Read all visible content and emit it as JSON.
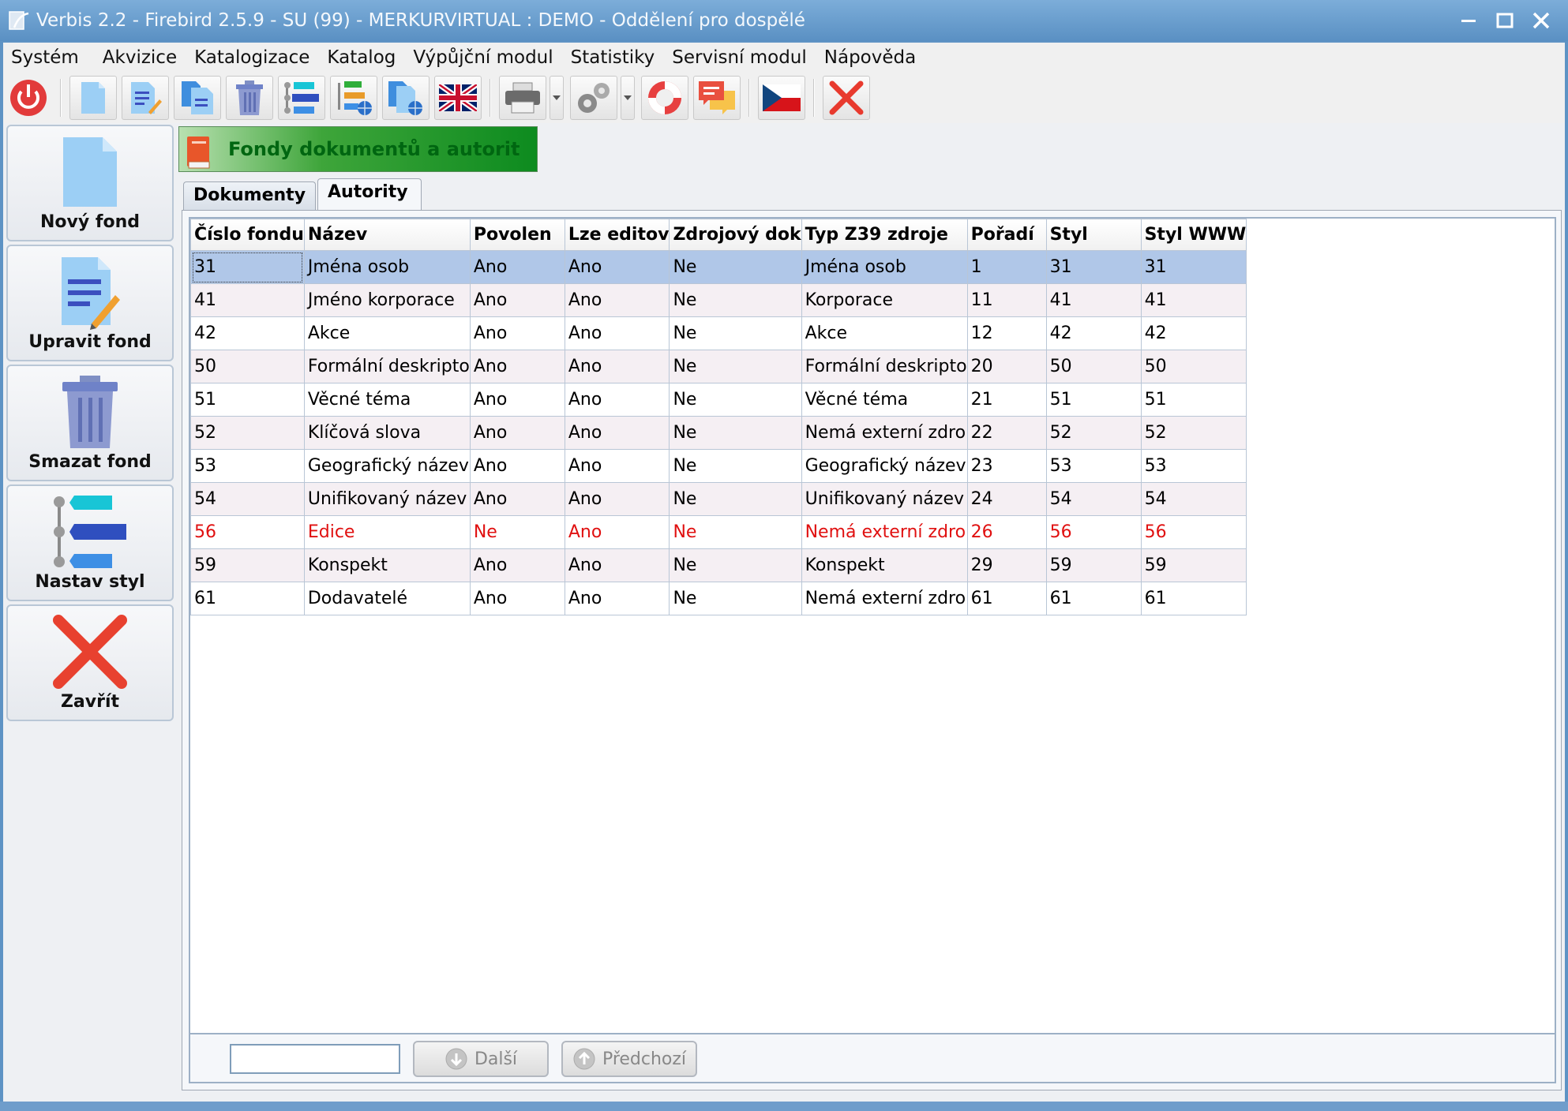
{
  "window": {
    "title": "Verbis 2.2 - Firebird 2.5.9 - SU (99) - MERKURVIRTUAL : DEMO - Oddělení pro dospělé"
  },
  "menu": [
    "Systém",
    "Akvizice",
    "Katalogizace",
    "Katalog",
    "Výpůjční modul",
    "Statistiky",
    "Servisní modul",
    "Nápověda"
  ],
  "sidebar": {
    "new_fund": "Nový fond",
    "edit_fund": "Upravit fond",
    "delete_fund": "Smazat fond",
    "set_style": "Nastav styl",
    "close": "Zavřít"
  },
  "panel": {
    "title": "Fondy dokumentů a autorit"
  },
  "tabs": [
    {
      "label": "Dokumenty",
      "active": false
    },
    {
      "label": "Autority",
      "active": true
    }
  ],
  "grid": {
    "columns": [
      "Číslo fondu",
      "Název",
      "Povolen",
      "Lze editov",
      "Zdrojový dok",
      "Typ Z39 zdroje",
      "Pořadí",
      "Styl",
      "Styl WWW"
    ],
    "rows": [
      [
        "31",
        "Jména osob",
        "Ano",
        "Ano",
        "Ne",
        "Jména osob",
        "1",
        "31",
        "31"
      ],
      [
        "41",
        "Jméno korporace",
        "Ano",
        "Ano",
        "Ne",
        "Korporace",
        "11",
        "41",
        "41"
      ],
      [
        "42",
        "Akce",
        "Ano",
        "Ano",
        "Ne",
        "Akce",
        "12",
        "42",
        "42"
      ],
      [
        "50",
        "Formální deskripto",
        "Ano",
        "Ano",
        "Ne",
        "Formální deskripto",
        "20",
        "50",
        "50"
      ],
      [
        "51",
        "Věcné téma",
        "Ano",
        "Ano",
        "Ne",
        "Věcné téma",
        "21",
        "51",
        "51"
      ],
      [
        "52",
        "Klíčová slova",
        "Ano",
        "Ano",
        "Ne",
        "Nemá externí zdro",
        "22",
        "52",
        "52"
      ],
      [
        "53",
        "Geografický název",
        "Ano",
        "Ano",
        "Ne",
        "Geografický název",
        "23",
        "53",
        "53"
      ],
      [
        "54",
        "Unifikovaný název",
        "Ano",
        "Ano",
        "Ne",
        "Unifikovaný název",
        "24",
        "54",
        "54"
      ],
      [
        "56",
        "Edice",
        "Ne",
        "Ano",
        "Ne",
        "Nemá externí zdro",
        "26",
        "56",
        "56"
      ],
      [
        "59",
        "Konspekt",
        "Ano",
        "Ano",
        "Ne",
        "Konspekt",
        "29",
        "59",
        "59"
      ],
      [
        "61",
        "Dodavatelé",
        "Ano",
        "Ano",
        "Ne",
        "Nemá externí zdro",
        "61",
        "61",
        "61"
      ]
    ],
    "selected_row": 0,
    "disabled_row": 8
  },
  "search": {
    "value": "",
    "next_label": "Další",
    "prev_label": "Předchozí"
  },
  "colors": {
    "selection": "#b0c7e8",
    "disabled_text": "#e01010",
    "header_green": "#0d8b1f"
  }
}
